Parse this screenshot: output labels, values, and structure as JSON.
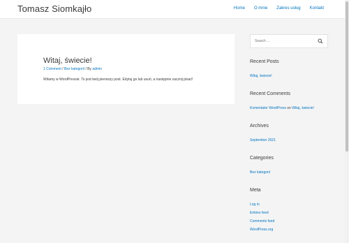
{
  "header": {
    "site_title": "Tomasz Siomkajło",
    "nav": [
      "Home",
      "O mnie",
      "Zakres usług",
      "Kontakt"
    ]
  },
  "post": {
    "title": "Witaj, świecie!",
    "comments": "1 Comment",
    "category": "Bez kategorii",
    "author_prefix": "By",
    "author": "admin",
    "excerpt": "Witamy w WordPressie. To jest twój pierwszy post. Edytuj go lub usuń, a następnie zacznij pisać!"
  },
  "sidebar": {
    "search_placeholder": "Search …",
    "recent_posts": {
      "title": "Recent Posts",
      "items": [
        "Witaj, świecie!"
      ]
    },
    "recent_comments": {
      "title": "Recent Comments",
      "author": "Komentator WordPress",
      "on": "on",
      "post": "Witaj, świecie!"
    },
    "archives": {
      "title": "Archives",
      "items": [
        "September 2021"
      ]
    },
    "categories": {
      "title": "Categories",
      "items": [
        "Bez kategorii"
      ]
    },
    "meta": {
      "title": "Meta",
      "items": [
        "Log in",
        "Entries feed",
        "Comments feed",
        "WordPress.org"
      ]
    }
  },
  "colors": {
    "link": "#0274be",
    "text": "#3a3a3a",
    "background": "#f4f4f5"
  }
}
